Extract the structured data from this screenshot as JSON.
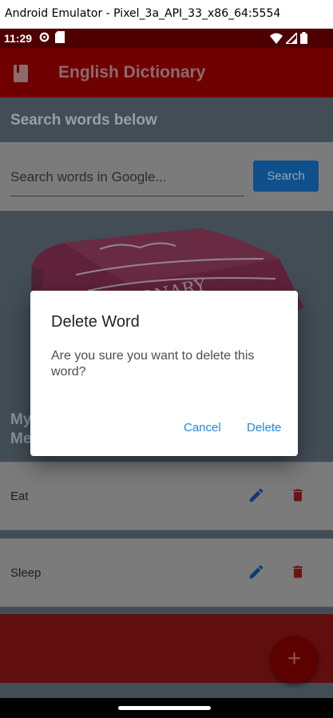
{
  "window": {
    "title": "Android Emulator - Pixel_3a_API_33_x86_64:5554"
  },
  "status_bar": {
    "time": "11:29"
  },
  "app": {
    "title": "English Dictionary"
  },
  "search": {
    "section_label": "Search words below",
    "placeholder": "Search words in Google...",
    "button_label": "Search"
  },
  "hero": {
    "book_label": "DICTIONARY"
  },
  "my_words": {
    "label_line1": "My",
    "label_line2": "Me",
    "items": [
      {
        "word": "Eat"
      },
      {
        "word": "Sleep"
      }
    ]
  },
  "dialog": {
    "title": "Delete Word",
    "message": "Are you sure you want to delete this word?",
    "cancel_label": "Cancel",
    "delete_label": "Delete"
  },
  "fab": {
    "label": "+"
  },
  "colors": {
    "app_bar": "#700000",
    "accent_blue": "#1e88e5",
    "delete_red": "#e53935",
    "fab": "#5d0000"
  }
}
